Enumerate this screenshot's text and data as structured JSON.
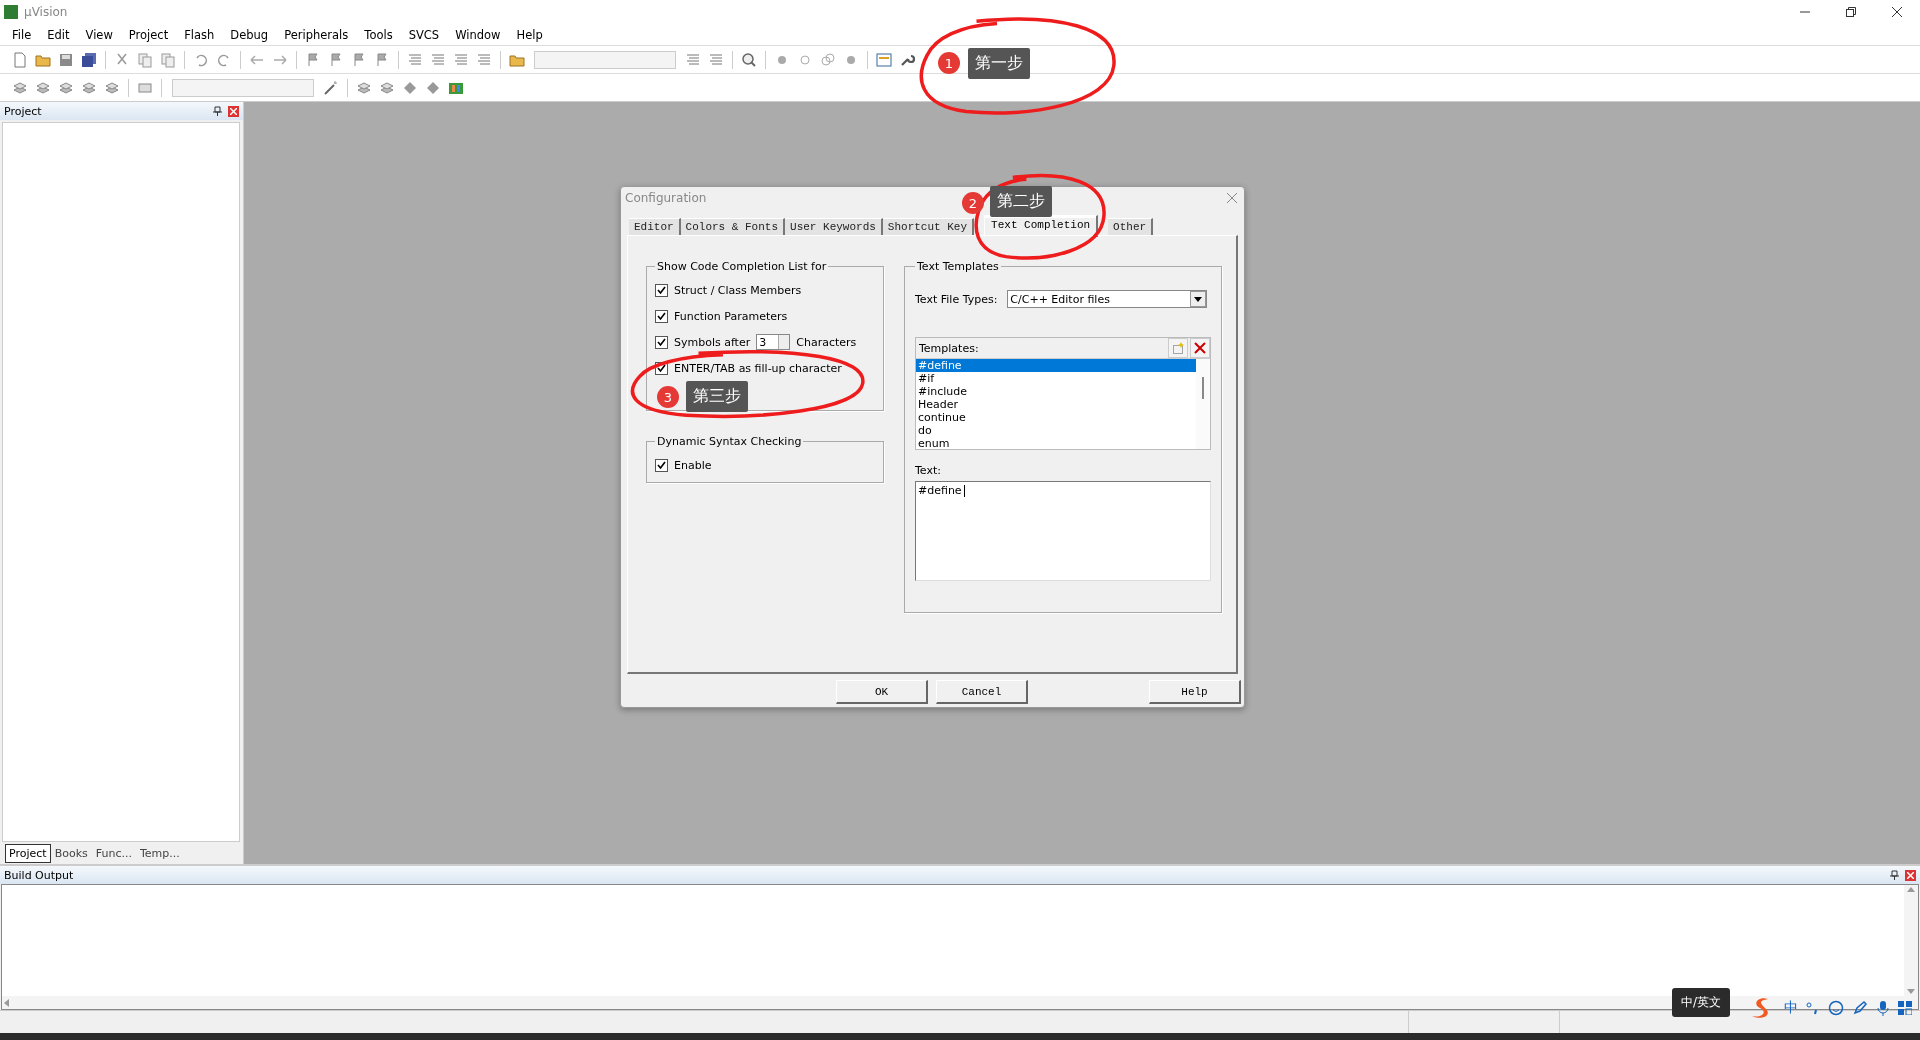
{
  "window": {
    "title": "µVision"
  },
  "menu": [
    "File",
    "Edit",
    "View",
    "Project",
    "Flash",
    "Debug",
    "Peripherals",
    "Tools",
    "SVCS",
    "Window",
    "Help"
  ],
  "project_panel": {
    "title": "Project",
    "tabs": [
      {
        "label": "Project",
        "selected": true
      },
      {
        "label": "Books",
        "selected": false
      },
      {
        "label": "Func...",
        "selected": false
      },
      {
        "label": "Temp...",
        "selected": false
      }
    ]
  },
  "dialog": {
    "title": "Configuration",
    "tabs": [
      {
        "label": "Editor",
        "selected": false
      },
      {
        "label": "Colors & Fonts",
        "selected": false
      },
      {
        "label": "User Keywords",
        "selected": false
      },
      {
        "label": "Shortcut Key",
        "selected": false
      },
      {
        "label": "Text Completion",
        "selected": true
      },
      {
        "label": "Other",
        "selected": false
      }
    ],
    "completion_group": {
      "title": "Show Code Completion List for",
      "items": [
        {
          "kind": "checkbox",
          "label": "Struct / Class Members",
          "checked": true
        },
        {
          "kind": "checkbox",
          "label": "Function Parameters",
          "checked": true
        },
        {
          "kind": "spin",
          "label": "Symbols after",
          "checked": true,
          "value": "3",
          "suffix": "Characters"
        },
        {
          "kind": "checkbox",
          "label": "ENTER/TAB as fill-up character",
          "checked": true
        }
      ]
    },
    "syntax_group": {
      "title": "Dynamic Syntax Checking",
      "items": [
        {
          "kind": "checkbox",
          "label": "Enable",
          "checked": true
        }
      ]
    },
    "templates_group": {
      "title": "Text Templates",
      "file_types_label": "Text File Types:",
      "file_types_value": "C/C++ Editor files",
      "templates_label": "Templates:",
      "templates": [
        {
          "label": "#define",
          "selected": true
        },
        {
          "label": "#if",
          "selected": false
        },
        {
          "label": "#include",
          "selected": false
        },
        {
          "label": "Header",
          "selected": false
        },
        {
          "label": "continue",
          "selected": false
        },
        {
          "label": "do",
          "selected": false
        },
        {
          "label": "enum",
          "selected": false
        }
      ],
      "text_label": "Text:",
      "text_value": "#define"
    },
    "buttons": [
      "OK",
      "Cancel",
      "Help"
    ]
  },
  "build_output": {
    "title": "Build Output"
  },
  "ime": {
    "tooltip": "中/英文",
    "mode": "中"
  },
  "annotations": [
    {
      "number": "1",
      "label": "第一步"
    },
    {
      "number": "2",
      "label": "第二步"
    },
    {
      "number": "3",
      "label": "第三步"
    }
  ]
}
